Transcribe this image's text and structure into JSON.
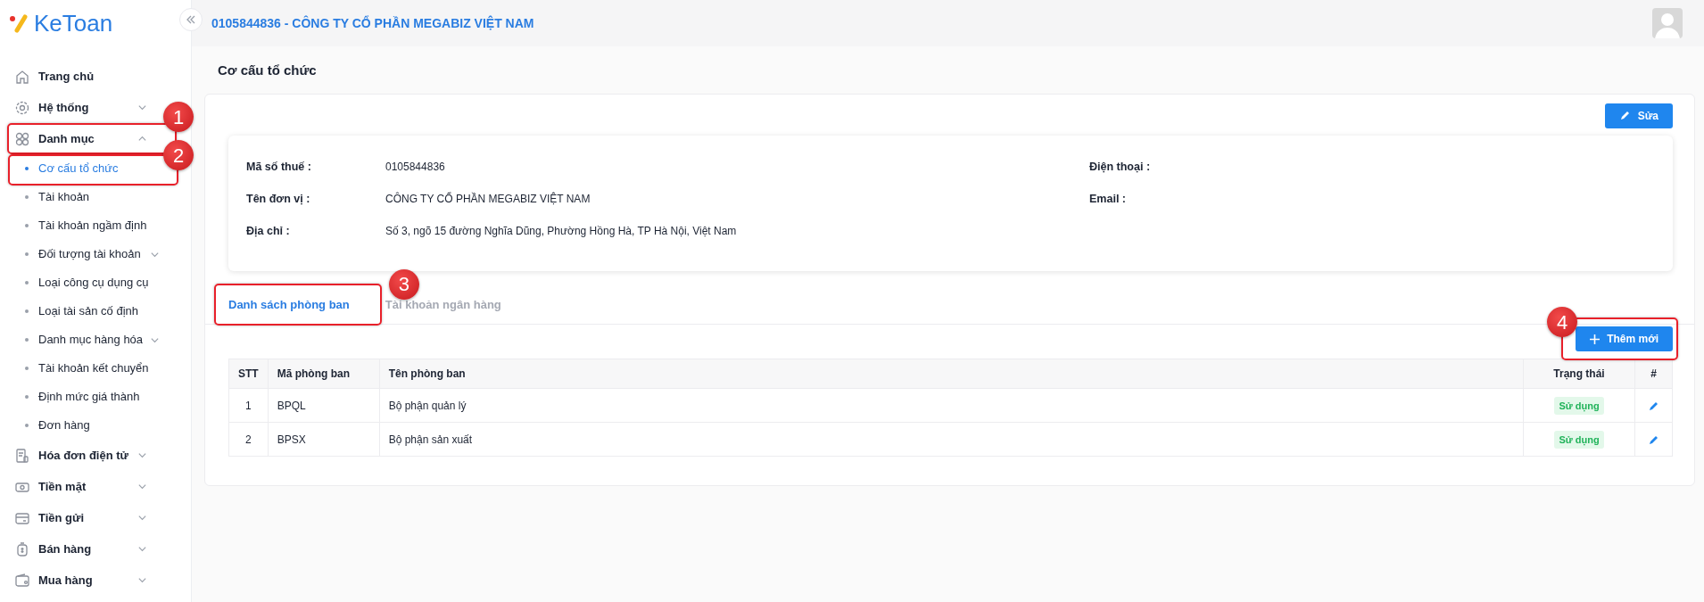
{
  "brand": {
    "accent": "Ke",
    "rest": "Toan"
  },
  "header": {
    "title": "0105844836 - CÔNG TY CỔ PHẦN MEGABIZ VIỆT NAM"
  },
  "sidebar": {
    "items": [
      {
        "label": "Trang chủ",
        "kind": "link"
      },
      {
        "label": "Hệ thống",
        "kind": "group",
        "expanded": false
      },
      {
        "label": "Danh mục",
        "kind": "group",
        "expanded": true,
        "callout": "1",
        "children": [
          {
            "label": "Cơ cấu tổ chức",
            "selected": true,
            "callout": "2"
          },
          {
            "label": "Tài khoản",
            "selected": false
          },
          {
            "label": "Tài khoản ngầm định",
            "selected": false
          },
          {
            "label": "Đối tượng tài khoản",
            "selected": false,
            "expanded": false
          },
          {
            "label": "Loại công cụ dụng cụ",
            "selected": false
          },
          {
            "label": "Loại tài sản cố định",
            "selected": false
          },
          {
            "label": "Danh mục hàng hóa",
            "selected": false,
            "expanded": false
          },
          {
            "label": "Tài khoản kết chuyển",
            "selected": false
          },
          {
            "label": "Định mức giá thành",
            "selected": false
          },
          {
            "label": "Đơn hàng",
            "selected": false
          }
        ]
      },
      {
        "label": "Hóa đơn điện tử",
        "kind": "group",
        "expanded": false
      },
      {
        "label": "Tiền mặt",
        "kind": "group",
        "expanded": false
      },
      {
        "label": "Tiền gửi",
        "kind": "group",
        "expanded": false
      },
      {
        "label": "Bán hàng",
        "kind": "group",
        "expanded": false
      },
      {
        "label": "Mua hàng",
        "kind": "group",
        "expanded": false
      }
    ]
  },
  "page": {
    "title": "Cơ cấu tổ chức",
    "edit_button": "Sửa",
    "info_left": [
      {
        "label": "Mã số thuế :",
        "value": "0105844836"
      },
      {
        "label": "Tên đơn vị :",
        "value": "CÔNG TY CỔ PHẦN MEGABIZ VIỆT NAM"
      },
      {
        "label": "Địa chỉ :",
        "value": "Số 3, ngõ 15 đường Nghĩa Dũng, Phường Hồng Hà, TP Hà Nội, Việt Nam"
      }
    ],
    "info_right": [
      {
        "label": "Điện thoại :"
      },
      {
        "label": "Email :"
      }
    ],
    "tabs": [
      {
        "label": "Danh sách phòng ban",
        "selected": true,
        "callout": "3"
      },
      {
        "label": "Tài khoản ngân hàng",
        "selected": false
      }
    ],
    "add_button": {
      "label": "Thêm mới",
      "callout": "4"
    },
    "table": {
      "columns": [
        "STT",
        "Mã phòng ban",
        "Tên phòng ban",
        "Trạng thái",
        "#"
      ],
      "rows": [
        {
          "stt": "1",
          "code": "BPQL",
          "name": "Bộ phận quản lý",
          "status": "Sử dụng"
        },
        {
          "stt": "2",
          "code": "BPSX",
          "name": "Bộ phận sản xuất",
          "status": "Sử dụng"
        }
      ]
    }
  }
}
